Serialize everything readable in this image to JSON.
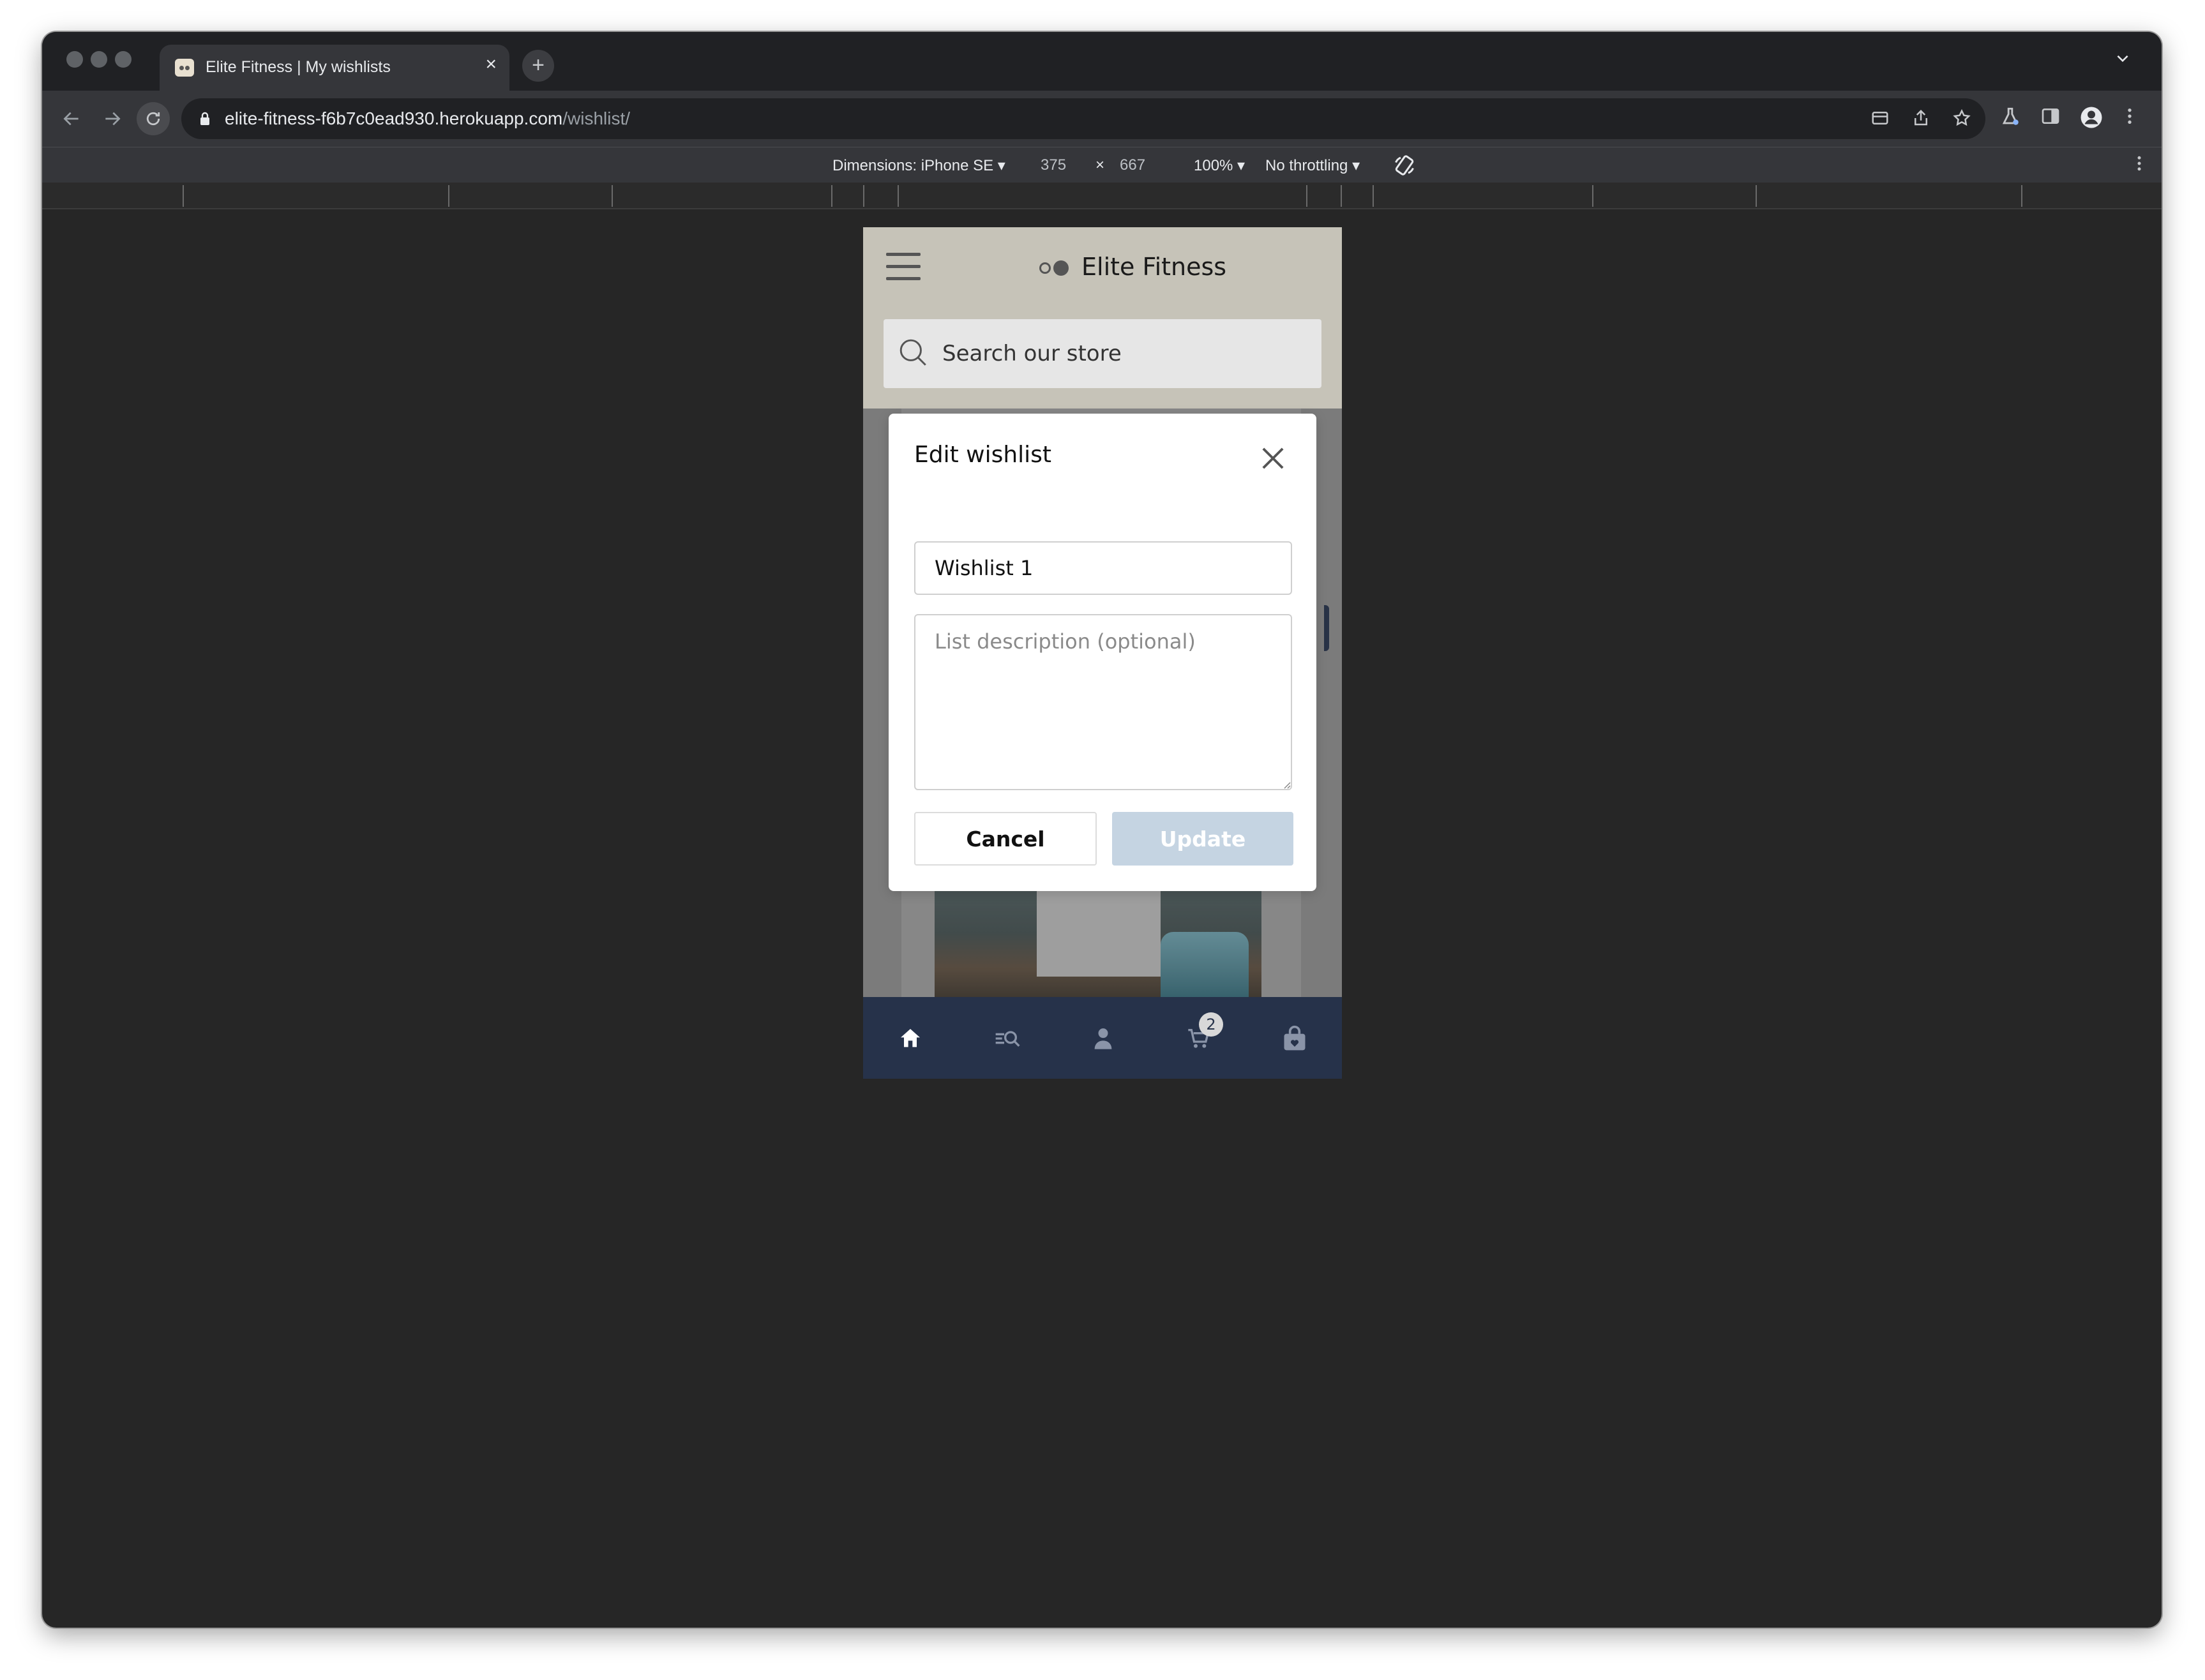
{
  "browser": {
    "tab_title": "Elite Fitness | My wishlists",
    "tab_close": "×",
    "new_tab": "+",
    "url_host": "elite-fitness-f6b7c0ead930.herokuapp.com",
    "url_path": "/wishlist/"
  },
  "device_toolbar": {
    "dimensions_label": "Dimensions: iPhone SE",
    "width": "375",
    "times": "×",
    "height": "667",
    "zoom": "100%",
    "throttling": "No throttling"
  },
  "site": {
    "brand": "Elite Fitness",
    "search_placeholder": "Search our store"
  },
  "modal": {
    "title": "Edit wishlist",
    "name_value": "Wishlist 1",
    "description_placeholder": "List description (optional)",
    "cancel_label": "Cancel",
    "update_label": "Update"
  },
  "bottom_nav": {
    "items": [
      "home-icon",
      "search-list-icon",
      "account-icon",
      "cart-icon",
      "bag-icon"
    ],
    "cart_count": "2"
  },
  "colors": {
    "header_bg": "#c6c3b8",
    "bottom_nav_bg": "#26324a",
    "update_disabled_bg": "#c5d4e2"
  }
}
